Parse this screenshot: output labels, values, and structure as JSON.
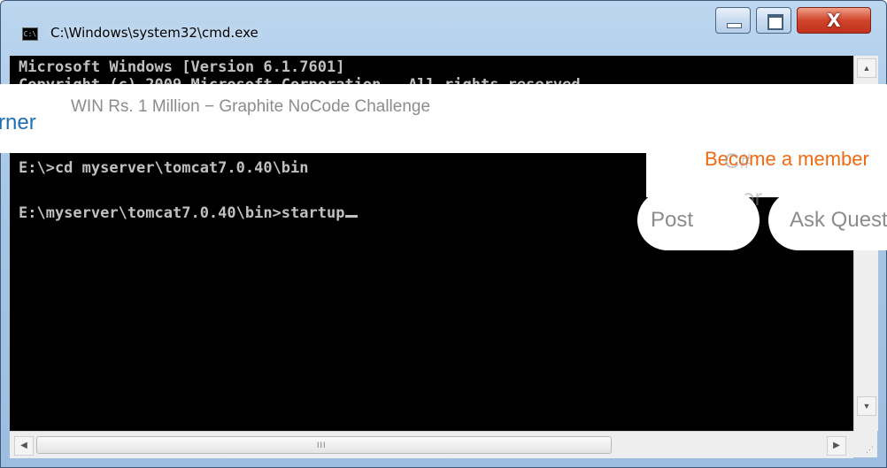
{
  "window": {
    "title": "C:\\Windows\\system32\\cmd.exe",
    "icon_label": "C:\\",
    "controls": {
      "minimize": "minimize-icon",
      "maximize": "maximize-icon",
      "close": "close-icon",
      "close_glyph": "X"
    }
  },
  "console": {
    "lines": [
      "Microsoft Windows [Version 6.1.7601]",
      "Copyright (c) 2009 Microsoft Corporation.  All rights reserved.",
      "E:\\>cd myserver\\tomcat7.0.40\\bin",
      "E:\\myserver\\tomcat7.0.40\\bin>startup"
    ]
  },
  "scrollbars": {
    "up_arrow": "▲",
    "down_arrow": "▼",
    "left_arrow": "◀",
    "right_arrow": "▶",
    "thumb_grip": "III"
  },
  "banner": {
    "brand_fragment": "rner",
    "promo_text": "WIN Rs. 1 Million − Graphite NoCode Challenge",
    "member_link": "Become a member",
    "csharp_ghost": "C#",
    "ghost_text": "or"
  },
  "actions": {
    "post": "Post",
    "ask": "Ask Question"
  }
}
